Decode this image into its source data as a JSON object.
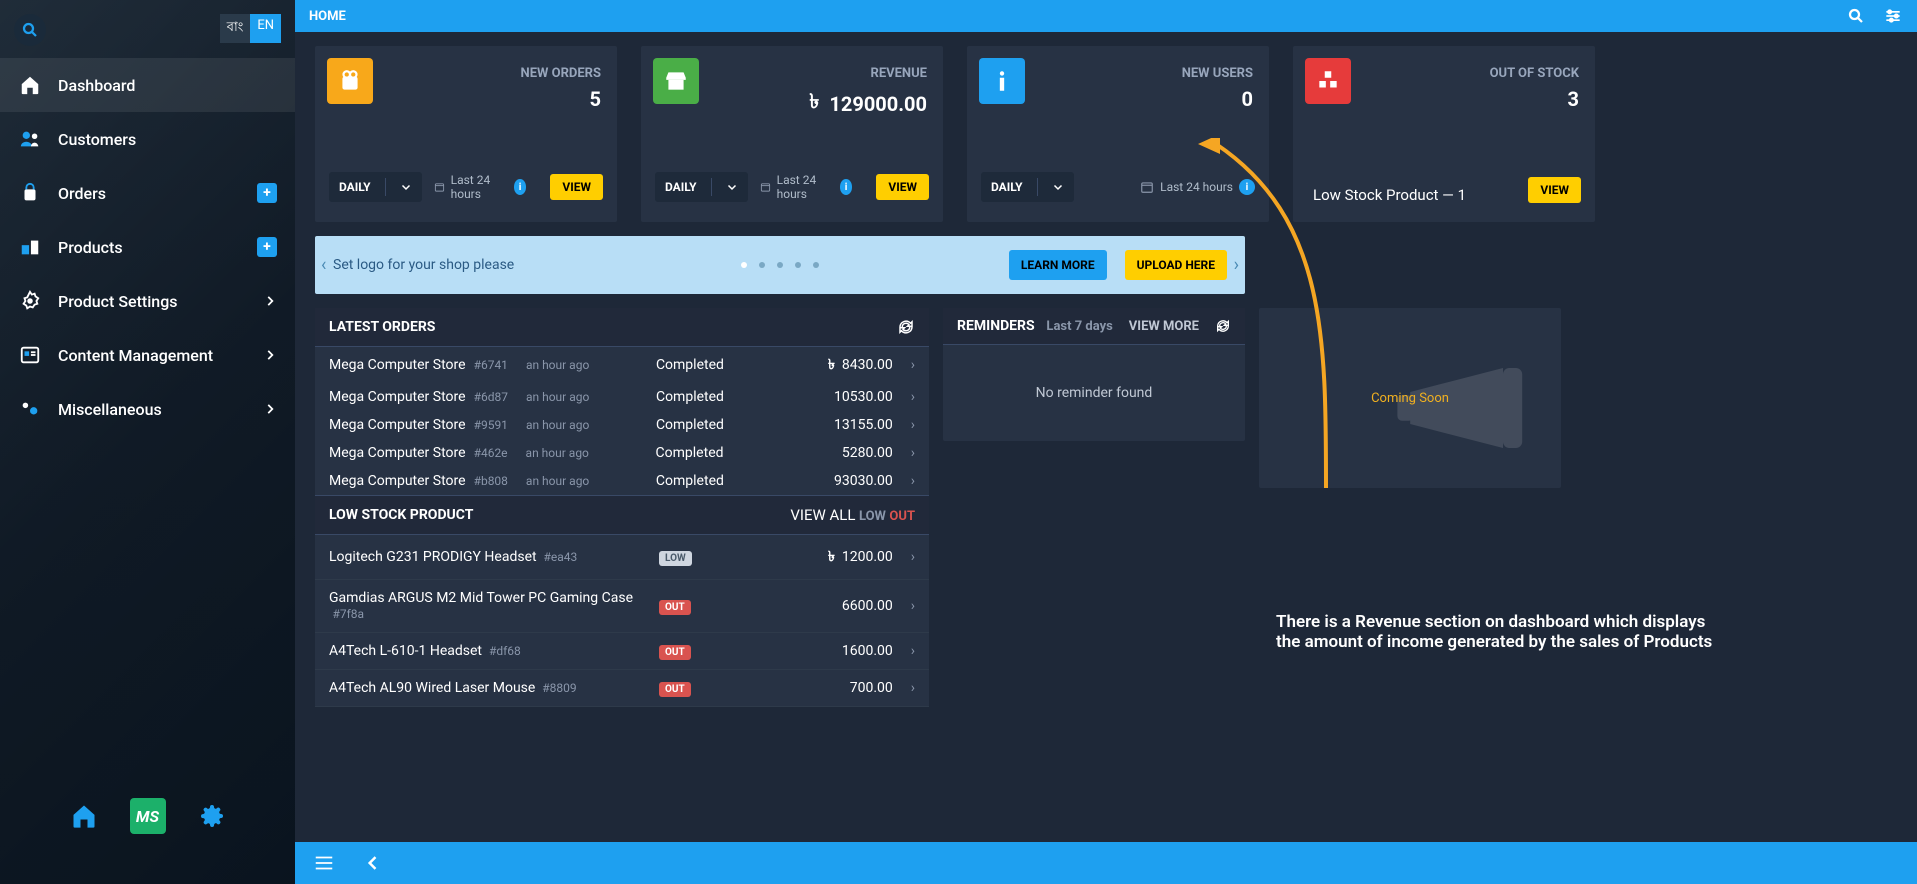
{
  "topbar": {
    "title": "HOME"
  },
  "lang": {
    "inactive": "বাং",
    "active": "EN"
  },
  "nav": {
    "items": [
      {
        "label": "Dashboard"
      },
      {
        "label": "Customers"
      },
      {
        "label": "Orders"
      },
      {
        "label": "Products"
      },
      {
        "label": "Product Settings"
      },
      {
        "label": "Content Management"
      },
      {
        "label": "Miscellaneous"
      }
    ]
  },
  "stats": {
    "new_orders": {
      "label": "NEW ORDERS",
      "value": "5",
      "period": "DAILY",
      "range": "Last 24 hours",
      "view": "VIEW"
    },
    "revenue": {
      "label": "REVENUE",
      "currency": "৳",
      "value": "129000.00",
      "period": "DAILY",
      "range": "Last 24 hours",
      "view": "VIEW"
    },
    "new_users": {
      "label": "NEW USERS",
      "value": "0",
      "period": "DAILY",
      "range": "Last 24 hours"
    },
    "out_stock": {
      "label": "OUT OF STOCK",
      "value": "3",
      "sub": "Low Stock Product — 1",
      "view": "VIEW"
    }
  },
  "banner": {
    "text": "Set logo for your shop please",
    "learn_more": "LEARN MORE",
    "upload_here": "UPLOAD HERE"
  },
  "latest_orders": {
    "title": "LATEST ORDERS",
    "rows": [
      {
        "store": "Mega Computer Store",
        "hash": "#6741",
        "time": "an hour ago",
        "status": "Completed",
        "currency": "৳",
        "amount": "8430.00"
      },
      {
        "store": "Mega Computer Store",
        "hash": "#6d87",
        "time": "an hour ago",
        "status": "Completed",
        "currency": "",
        "amount": "10530.00"
      },
      {
        "store": "Mega Computer Store",
        "hash": "#9591",
        "time": "an hour ago",
        "status": "Completed",
        "currency": "",
        "amount": "13155.00"
      },
      {
        "store": "Mega Computer Store",
        "hash": "#462e",
        "time": "an hour ago",
        "status": "Completed",
        "currency": "",
        "amount": "5280.00"
      },
      {
        "store": "Mega Computer Store",
        "hash": "#b808",
        "time": "an hour ago",
        "status": "Completed",
        "currency": "",
        "amount": "93030.00"
      }
    ]
  },
  "low_stock": {
    "title": "LOW STOCK PRODUCT",
    "view_all": "VIEW ALL",
    "low_label": "LOW",
    "out_label": "OUT",
    "rows": [
      {
        "name": "Logitech G231 PRODIGY Headset",
        "hash": "#ea43",
        "tag": "LOW",
        "currency": "৳",
        "amount": "1200.00"
      },
      {
        "name": "Gamdias ARGUS M2 Mid Tower PC Gaming Case",
        "hash": "#7f8a",
        "tag": "OUT",
        "currency": "",
        "amount": "6600.00"
      },
      {
        "name": "A4Tech L-610-1 Headset",
        "hash": "#df68",
        "tag": "OUT",
        "currency": "",
        "amount": "1600.00"
      },
      {
        "name": "A4Tech AL90 Wired Laser Mouse",
        "hash": "#8809",
        "tag": "OUT",
        "currency": "",
        "amount": "700.00"
      }
    ]
  },
  "reminders": {
    "title": "REMINDERS",
    "range": "Last 7 days",
    "view_more": "VIEW MORE",
    "empty": "No reminder found"
  },
  "coming_soon": "Coming Soon",
  "annotation": {
    "text": "There is a Revenue section on dashboard which displays the amount of income generated by the sales of Products"
  }
}
